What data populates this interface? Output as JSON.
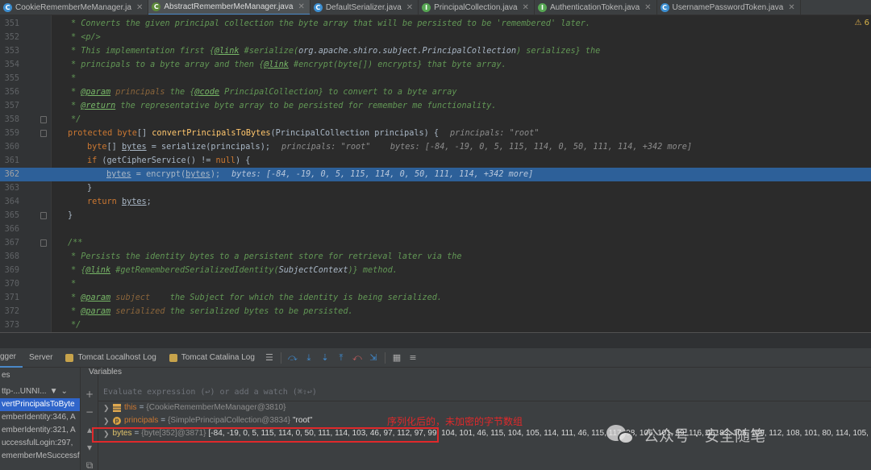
{
  "tabs": [
    {
      "label": "CookieRememberMeManager.ja",
      "icon": "C",
      "active": false
    },
    {
      "label": "AbstractRememberMeManager.java",
      "icon": "C",
      "active": true
    },
    {
      "label": "DefaultSerializer.java",
      "icon": "C",
      "active": false
    },
    {
      "label": "PrincipalCollection.java",
      "icon": "I",
      "active": false
    },
    {
      "label": "AuthenticationToken.java",
      "icon": "I",
      "active": false
    },
    {
      "label": "UsernamePasswordToken.java",
      "icon": "C",
      "active": false
    }
  ],
  "editor": {
    "warning_count": "6",
    "lines": [
      {
        "n": "351"
      },
      {
        "n": "352"
      },
      {
        "n": "353"
      },
      {
        "n": "354"
      },
      {
        "n": "355"
      },
      {
        "n": "356"
      },
      {
        "n": "357"
      },
      {
        "n": "358"
      },
      {
        "n": "359"
      },
      {
        "n": "360"
      },
      {
        "n": "361"
      },
      {
        "n": "362"
      },
      {
        "n": "363"
      },
      {
        "n": "364"
      },
      {
        "n": "365"
      },
      {
        "n": "366"
      },
      {
        "n": "367"
      },
      {
        "n": "368"
      },
      {
        "n": "369"
      },
      {
        "n": "370"
      },
      {
        "n": "371"
      },
      {
        "n": "372"
      },
      {
        "n": "373"
      }
    ],
    "code": {
      "l351": "* Converts the given principal collection the byte array that will be persisted to be 'remembered' later.",
      "l352": "* <p/>",
      "l353_a": "* This implementation first {",
      "l353_tag": "@link",
      "l353_b": " #serialize(",
      "l353_c": "org.apache.shiro.subject.PrincipalCollection",
      "l353_d": ") serializes}",
      "l353_e": " the",
      "l354_a": "* principals to a byte array and then {",
      "l354_tag": "@link",
      "l354_b": " #encrypt(byte[]) encrypts}",
      "l354_c": " that byte array.",
      "l355": "*",
      "l356_a": "* ",
      "l356_tag": "@param",
      "l356_b": " principals",
      "l356_c": " the {",
      "l356_code": "@code",
      "l356_d": " PrincipalCollection}",
      "l356_e": " to convert to a byte array",
      "l357_a": "* ",
      "l357_tag": "@return",
      "l357_b": " the representative byte array to be persisted for remember me functionality.",
      "l358": "*/",
      "l359_kw": "protected ",
      "l359_type": "byte",
      "l359_a": "[] ",
      "l359_fn": "convertPrincipalsToBytes",
      "l359_b": "(PrincipalCollection principals) {",
      "l359_hint": "principals: \"root\"",
      "l360_kw": "byte",
      "l360_a": "[] ",
      "l360_var": "bytes",
      "l360_b": " = serialize(principals);",
      "l360_hint": "principals: \"root\"    bytes: [-84, -19, 0, 5, 115, 114, 0, 50, 111, 114, +342 more]",
      "l361_kw": "if",
      "l361_a": " (getCipherService() != ",
      "l361_null": "null",
      "l361_b": ") {",
      "l362_var": "bytes",
      "l362_a": " = encrypt(",
      "l362_var2": "bytes",
      "l362_b": ");",
      "l362_hint": "bytes: [-84, -19, 0, 5, 115, 114, 0, 50, 111, 114, +342 more]",
      "l363": "}",
      "l364_kw": "return",
      "l364_var": "bytes",
      "l364_b": ";",
      "l365": "}",
      "l367": "/**",
      "l368": "* Persists the identity bytes to a persistent store for retrieval later via the",
      "l369_a": "* {",
      "l369_tag": "@link",
      "l369_b": " #getRememberedSerializedIdentity(",
      "l369_c": "SubjectContext",
      "l369_d": ")}",
      "l369_e": " method.",
      "l370": "*",
      "l371_a": "* ",
      "l371_tag": "@param",
      "l371_b": " subject",
      "l371_c": "    the Subject for which the identity is being serialized.",
      "l372_a": "* ",
      "l372_tag": "@param",
      "l372_b": " serialized",
      "l372_c": " the serialized bytes to be persisted.",
      "l373": "*/"
    }
  },
  "debug": {
    "tabs": [
      "gger",
      "Server",
      "Tomcat Localhost Log",
      "Tomcat Catalina Log"
    ],
    "frames_header": "es",
    "thread": "ttp-...UNNI...",
    "frames": [
      {
        "label": "vertPrincipalsToByte",
        "selected": true
      },
      {
        "label": "emberIdentity:346, A",
        "selected": false
      },
      {
        "label": "emberIdentity:321, A",
        "selected": false
      },
      {
        "label": "uccessfulLogin:297,",
        "selected": false
      },
      {
        "label": "ememberMeSuccessfu",
        "selected": false
      }
    ],
    "variables_header": "Variables",
    "eval_placeholder": "Evaluate expression (↩) or add a watch (⌘⇧↩)",
    "variables": [
      {
        "name": "this",
        "type": "{CookieRememberMeManager@3810}",
        "value": "",
        "icon": "this"
      },
      {
        "name": "principals",
        "type": "{SimplePrincipalCollection@3834}",
        "value": "\"root\"",
        "icon": "p"
      },
      {
        "name": "bytes",
        "type": "{byte[352]@3871}",
        "value": "[-84, -19, 0, 5, 115, 114, 0, 50, 111, 114, 103, 46, 97, 112, 97, 99, 104, 101, 46, 115, 104, 105, 114, 111, 46, 115, 117, 98, 106, 101, 99, 116, 46, 83, 105, 109, 112, 108, 101, 80, 114, 105, 110",
        "icon": "arr"
      }
    ]
  },
  "annotation": {
    "text": "序列化后的，未加密的字节数组"
  },
  "watermark": {
    "text": "公众号 · 安全随笔"
  },
  "colors": {
    "background": "#2b2b2b",
    "current_line": "#2d6099",
    "annotation_red": "#e0292b"
  }
}
